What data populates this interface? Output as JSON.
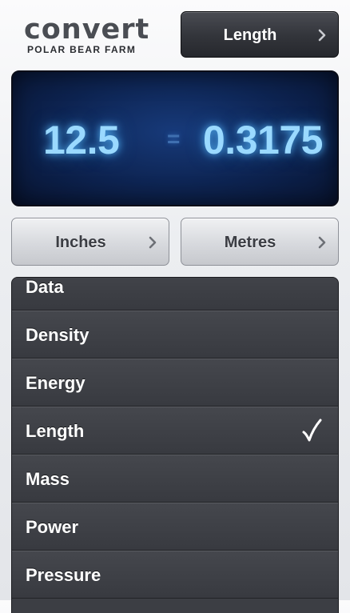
{
  "header": {
    "logo_text": "convert",
    "logo_subtitle": "POLAR BEAR FARM",
    "category_button": {
      "label": "Length",
      "icon": "chevron-right-icon"
    }
  },
  "display": {
    "input_value": "12.5",
    "equals": "=",
    "output_value": "0.3175",
    "glow_color": "#9ad9ff"
  },
  "units": {
    "from": {
      "label": "Inches",
      "icon": "chevron-right-icon"
    },
    "to": {
      "label": "Metres",
      "icon": "chevron-right-icon"
    }
  },
  "category_list": {
    "items": [
      {
        "label": "Data",
        "selected": false
      },
      {
        "label": "Density",
        "selected": false
      },
      {
        "label": "Energy",
        "selected": false
      },
      {
        "label": "Length",
        "selected": true
      },
      {
        "label": "Mass",
        "selected": false
      },
      {
        "label": "Power",
        "selected": false
      },
      {
        "label": "Pressure",
        "selected": false
      }
    ],
    "selected_icon": "checkmark-icon"
  }
}
